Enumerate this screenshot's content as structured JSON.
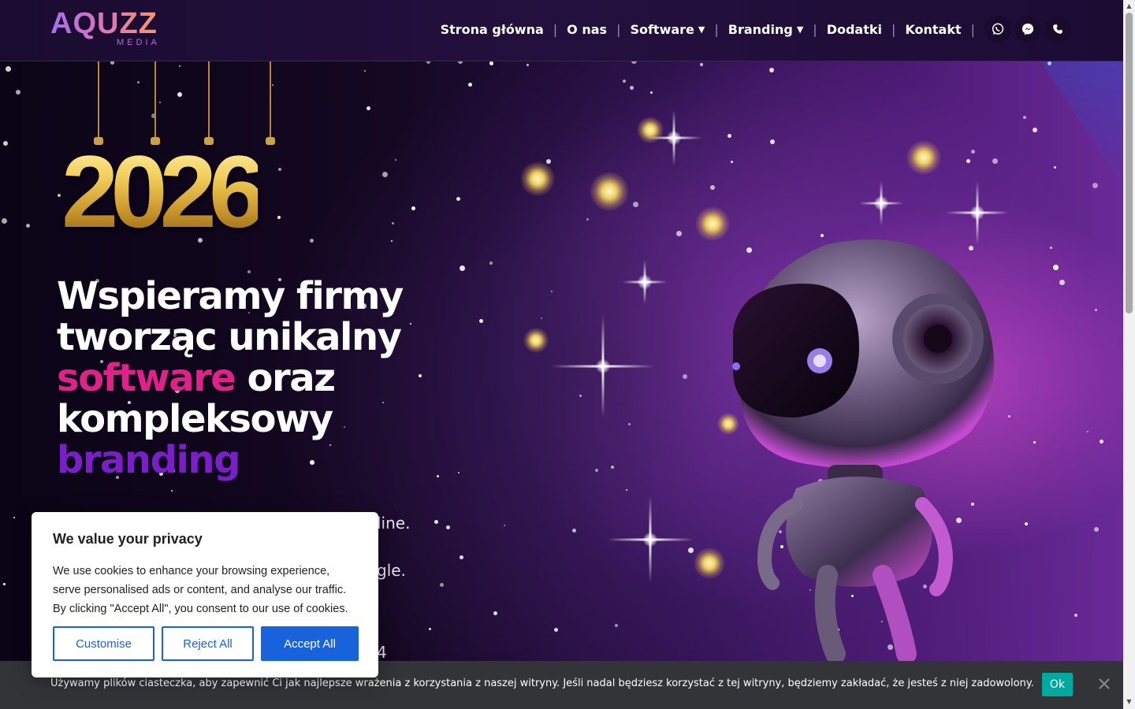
{
  "brand": {
    "logo_main": "AQUZZ",
    "logo_sub": "MEDIA"
  },
  "nav": {
    "items": [
      {
        "label": "Strona główna",
        "has_dropdown": false
      },
      {
        "label": "O nas",
        "has_dropdown": false
      },
      {
        "label": "Software",
        "has_dropdown": true
      },
      {
        "label": "Branding",
        "has_dropdown": true
      },
      {
        "label": "Dodatki",
        "has_dropdown": false
      },
      {
        "label": "Kontakt",
        "has_dropdown": false
      }
    ],
    "contact_icons": [
      "whatsapp-icon",
      "messenger-icon",
      "phone-icon"
    ]
  },
  "hero": {
    "year": "2026",
    "headline": {
      "line1": "Wspieramy firmy",
      "line2": "tworząc unikalny",
      "highlight1": "software",
      "line3_rest": " oraz",
      "line4": "kompleksowy",
      "highlight2": "branding"
    },
    "partial_text": {
      "frag1": "line.",
      "frag2": "gle.",
      "frag3": "4"
    }
  },
  "privacy": {
    "title": "We value your privacy",
    "body": "We use cookies to enhance your browsing experience, serve personalised ads or content, and analyse our traffic. By clicking \"Accept All\", you consent to our use of cookies.",
    "customise": "Customise",
    "reject": "Reject All",
    "accept": "Accept All"
  },
  "cookie_bar": {
    "text": "Używamy plików ciasteczka, aby zapewnić Ci jak najlepsze wrażenia z korzystania z naszej witryny. Jeśli nadal będziesz korzystać z tej witryny, będziemy zakładać, że jesteś z niej zadowolony.",
    "ok": "Ok"
  },
  "colors": {
    "accent_pink": "#e0218a",
    "accent_purple": "#7a1fc8",
    "button_blue": "#1863dc",
    "ok_teal": "#00a99d"
  }
}
